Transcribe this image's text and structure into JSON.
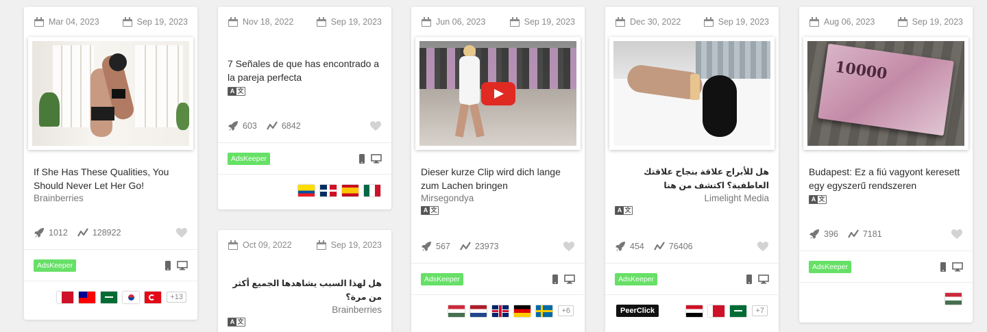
{
  "cards": [
    {
      "date_created": "Mar 04, 2023",
      "date_updated": "Sep 19, 2023",
      "title": "If She Has These Qualities, You Should Never Let Her Go!",
      "source": "Brainberries",
      "rockets": "1012",
      "trend": "128922",
      "network": "AdsKeeper",
      "more": "+13"
    },
    {
      "date_created": "Nov 18, 2022",
      "date_updated": "Sep 19, 2023",
      "title": "7 Señales de que has encontrado a la pareja perfecta",
      "rockets": "603",
      "trend": "6842",
      "network": "AdsKeeper"
    },
    {
      "date_created": "Oct 09, 2022",
      "date_updated": "Sep 19, 2023",
      "title": "هل لهذا السبب يشاهدها الجميع أكثر من مرة؟",
      "source": "Brainberries"
    },
    {
      "date_created": "Jun 06, 2023",
      "date_updated": "Sep 19, 2023",
      "title": "Dieser kurze Clip wird dich lange zum Lachen bringen",
      "source": "Mirsegondya",
      "rockets": "567",
      "trend": "23973",
      "network": "AdsKeeper",
      "more": "+6"
    },
    {
      "date_created": "Dec 30, 2022",
      "date_updated": "Sep 19, 2023",
      "title": "هل للأبراج علاقة بنجاح علاقتك العاطفية؟ اكتشف من هنا",
      "source": "Limelight Media",
      "rockets": "454",
      "trend": "76406",
      "network": "AdsKeeper",
      "network2": "PeerClick",
      "more": "+7"
    },
    {
      "date_created": "Aug 06, 2023",
      "date_updated": "Sep 19, 2023",
      "title": "Budapest: Ez a fiú vagyont keresett egy egyszerű rendszeren",
      "rockets": "396",
      "trend": "7181",
      "network": "AdsKeeper"
    }
  ],
  "icons": {
    "calendar": "calendar-icon",
    "rocket": "rocket-icon",
    "trend": "trend-icon",
    "heart": "heart-icon",
    "mobile": "mobile-icon",
    "desktop": "desktop-icon",
    "translate": "translate-icon"
  },
  "colors": {
    "ads_badge": "#66e066",
    "peerclick_badge": "#111111",
    "play_button": "#e12a22"
  }
}
